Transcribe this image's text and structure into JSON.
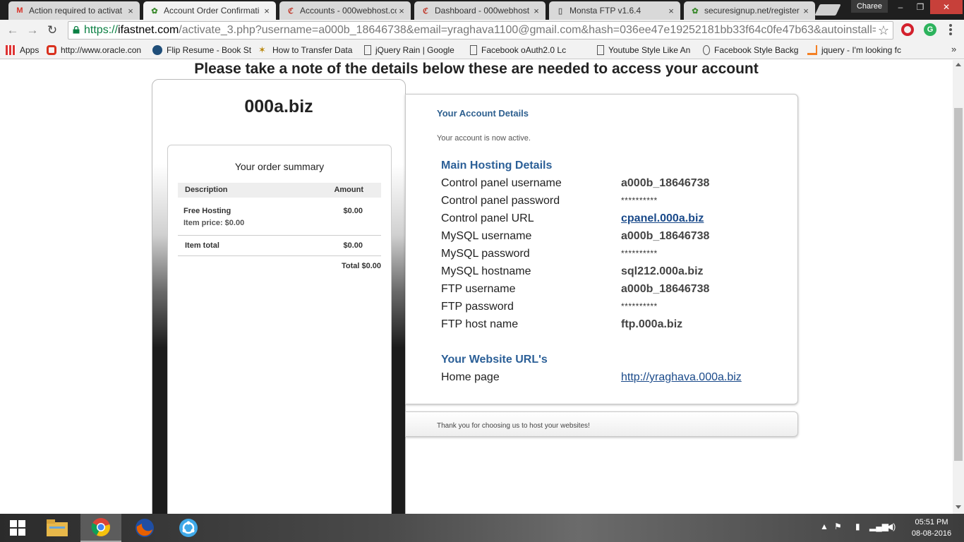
{
  "browser": {
    "tabs": [
      {
        "title": "Action required to activat",
        "icon": "gmail-icon"
      },
      {
        "title": "Account Order Confirmati",
        "icon": "leaf-icon"
      },
      {
        "title": "Accounts - 000webhost.cc",
        "icon": "webhost-icon"
      },
      {
        "title": "Dashboard - 000webhost",
        "icon": "webhost-icon"
      },
      {
        "title": "Monsta FTP v1.6.4",
        "icon": "page-icon"
      },
      {
        "title": "securesignup.net/register",
        "icon": "leaf-icon"
      }
    ],
    "profile_name": "Charee",
    "url_scheme": "https://",
    "url_host": "ifastnet.com",
    "url_path": "/activate_3.php?username=a000b_18646738&email=yraghava1100@gmail.com&hash=036ee47e19252181bb33f64c0fe47b63&autoinstall=",
    "bookmarks": [
      {
        "label": "Apps",
        "icon": "apps-grid-icon"
      },
      {
        "label": "http://www.oracle.con",
        "icon": "oracle-icon"
      },
      {
        "label": "Flip Resume - Book St",
        "icon": "flip-icon"
      },
      {
        "label": "How to Transfer Data",
        "icon": "star-badge-icon"
      },
      {
        "label": "jQuery Rain | Google",
        "icon": "page-icon"
      },
      {
        "label": "Facebook oAuth2.0 Lc",
        "icon": "page-icon"
      },
      {
        "label": "Youtube Style Like An",
        "icon": "page-icon"
      },
      {
        "label": "Facebook Style Backg",
        "icon": "drop-icon"
      },
      {
        "label": "jquery - I'm looking fc",
        "icon": "stackoverflow-icon"
      }
    ],
    "bookmarks_more": "»"
  },
  "page": {
    "heading": "Please take a note of the details below these are needed to access your account",
    "domain": "000a.biz",
    "order": {
      "title": "Your order summary",
      "col_description": "Description",
      "col_amount": "Amount",
      "item_name": "Free Hosting",
      "item_price": "Item price: $0.00",
      "item_amount": "$0.00",
      "item_total_label": "Item total",
      "item_total_amount": "$0.00",
      "grand_total": "Total $0.00"
    },
    "details": {
      "title": "Your Account Details",
      "status": "Your account is now active.",
      "hosting_heading": "Main Hosting Details",
      "rows": [
        {
          "label": "Control panel username",
          "value": "a000b_18646738"
        },
        {
          "label": "Control panel password",
          "value": "**********"
        },
        {
          "label": "Control panel URL",
          "value": "cpanel.000a.biz"
        },
        {
          "label": "MySQL username",
          "value": "a000b_18646738"
        },
        {
          "label": "MySQL password",
          "value": "**********"
        },
        {
          "label": "MySQL hostname",
          "value": "sql212.000a.biz"
        },
        {
          "label": "FTP username",
          "value": "a000b_18646738"
        },
        {
          "label": "FTP password",
          "value": "**********"
        },
        {
          "label": "FTP host name",
          "value": "ftp.000a.biz"
        }
      ],
      "website_heading": "Your Website URL's",
      "homepage_label": "Home page",
      "homepage_value": "http://yraghava.000a.biz"
    },
    "thanks": "Thank you for choosing us to host your websites!"
  },
  "taskbar": {
    "time": "05:51 PM",
    "date": "08-08-2016"
  },
  "colors": {
    "accent_blue": "#2b5f97",
    "url_green": "#0b8043",
    "close_red": "#c7403a"
  }
}
